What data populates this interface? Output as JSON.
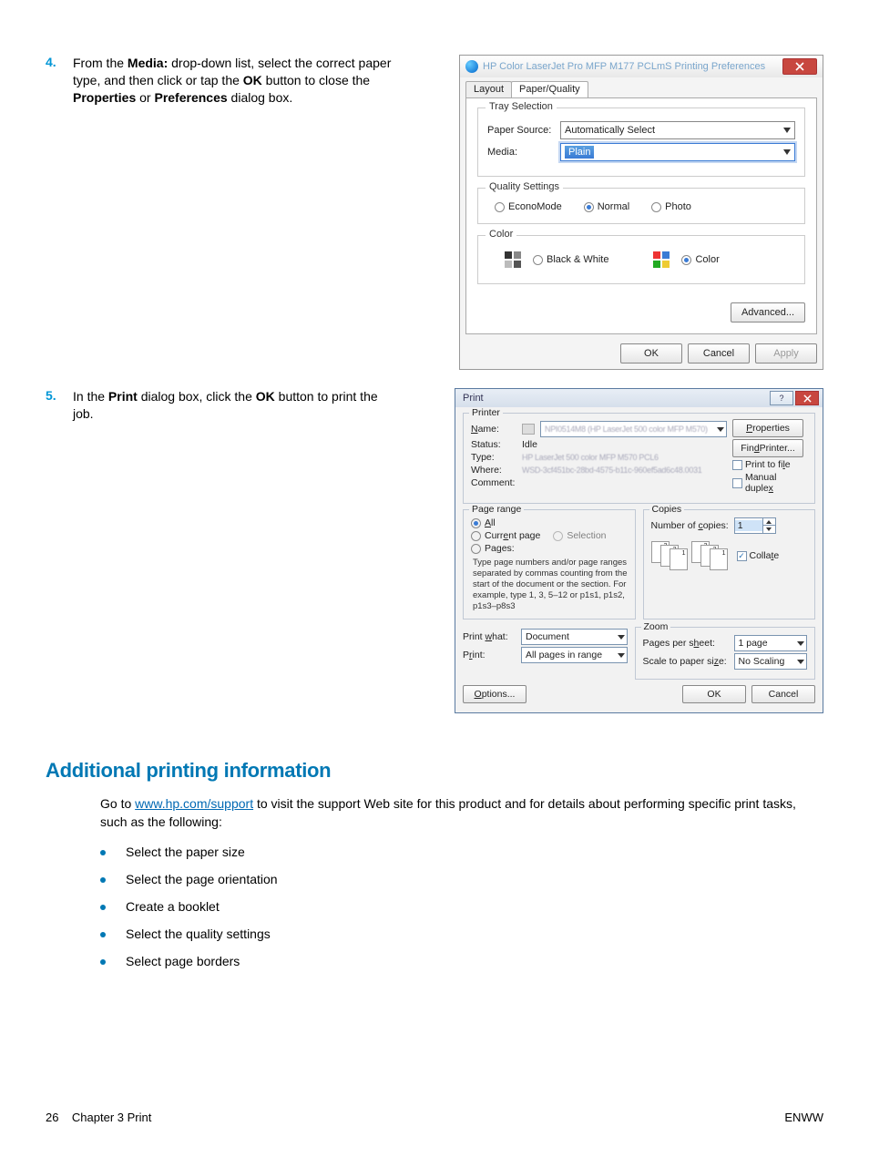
{
  "steps": {
    "s4": {
      "num": "4.",
      "text_prefix": "From the ",
      "b1": "Media:",
      "text_mid1": " drop-down list, select the correct paper type, and then click or tap the ",
      "b2": "OK",
      "text_mid2": " button to close the ",
      "b3": "Properties",
      "text_mid3": " or ",
      "b4": "Preferences",
      "text_end": " dialog box."
    },
    "s5": {
      "num": "5.",
      "text_prefix": "In the ",
      "b1": "Print",
      "text_mid1": " dialog box, click the ",
      "b2": "OK",
      "text_end": " button to print the job."
    }
  },
  "dlg1": {
    "title": "HP Color LaserJet Pro MFP M177 PCLmS Printing Preferences",
    "tab_layout": "Layout",
    "tab_pq": "Paper/Quality",
    "grp_tray": "Tray Selection",
    "lbl_paper_source": "Paper Source:",
    "val_paper_source": "Automatically Select",
    "lbl_media": "Media:",
    "val_media": "Plain",
    "grp_quality": "Quality Settings",
    "opt_econo": "EconoMode",
    "opt_normal": "Normal",
    "opt_photo": "Photo",
    "grp_color": "Color",
    "opt_bw": "Black & White",
    "opt_color": "Color",
    "btn_adv": "Advanced...",
    "btn_ok": "OK",
    "btn_cancel": "Cancel",
    "btn_apply": "Apply"
  },
  "dlg2": {
    "title": "Print",
    "grp_printer": "Printer",
    "lbl_name": "Name:",
    "lbl_status": "Status:",
    "val_status": "Idle",
    "lbl_type": "Type:",
    "lbl_where": "Where:",
    "lbl_comment": "Comment:",
    "btn_properties": "Properties",
    "btn_find": "Find Printer...",
    "chk_ptf": "Print to file",
    "chk_md": "Manual duplex",
    "grp_pagerange": "Page range",
    "opt_all": "All",
    "opt_current": "Current page",
    "opt_selection": "Selection",
    "opt_pages": "Pages:",
    "pages_hint": "Type page numbers and/or page ranges separated by commas counting from the start of the document or the section. For example, type 1, 3, 5–12 or p1s1, p1s2, p1s3–p8s3",
    "grp_copies": "Copies",
    "lbl_numcopies": "Number of copies:",
    "val_numcopies": "1",
    "chk_collate": "Collate",
    "lbl_printwhat": "Print what:",
    "val_printwhat": "Document",
    "lbl_print": "Print:",
    "val_print": "All pages in range",
    "grp_zoom": "Zoom",
    "lbl_pps": "Pages per sheet:",
    "val_pps": "1 page",
    "lbl_scale": "Scale to paper size:",
    "val_scale": "No Scaling",
    "btn_options": "Options...",
    "btn_ok": "OK",
    "btn_cancel": "Cancel"
  },
  "section": {
    "heading": "Additional printing information",
    "para_pre": "Go to ",
    "link_text": "www.hp.com/support",
    "para_post": " to visit the support Web site for this product and for details about performing specific print tasks, such as the following:",
    "b1": "Select the paper size",
    "b2": "Select the page orientation",
    "b3": "Create a booklet",
    "b4": "Select the quality settings",
    "b5": "Select page borders"
  },
  "footer": {
    "left_num": "26",
    "left_text": "Chapter 3   Print",
    "right": "ENWW"
  }
}
